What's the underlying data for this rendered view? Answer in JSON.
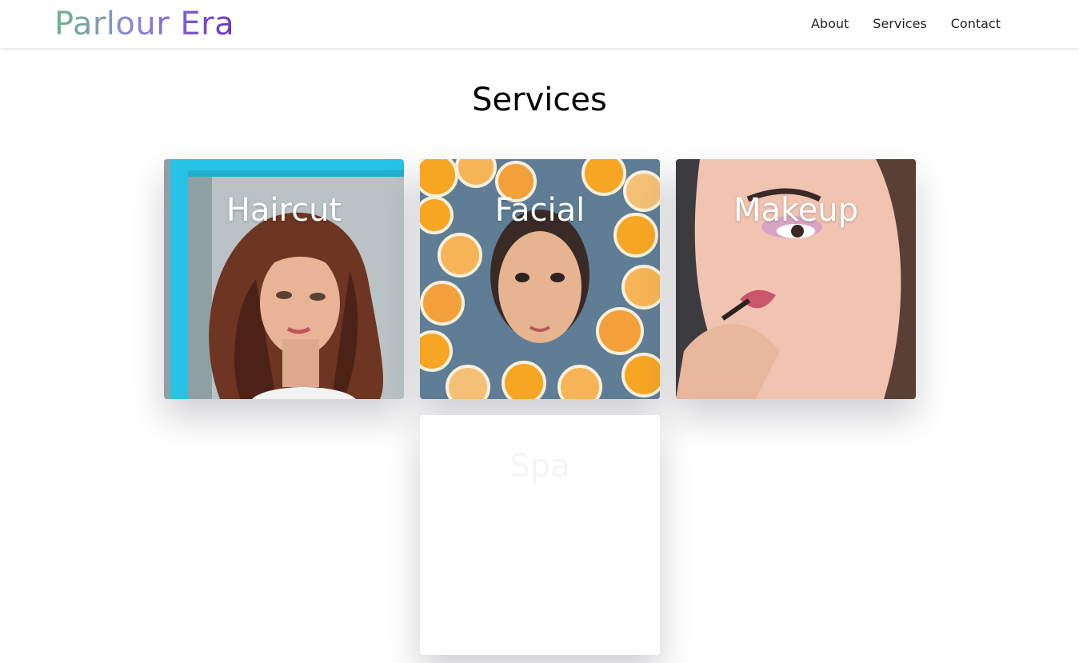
{
  "header": {
    "logo": "Parlour Era",
    "nav": [
      {
        "label": "About"
      },
      {
        "label": "Services"
      },
      {
        "label": "Contact"
      }
    ]
  },
  "main": {
    "title": "Services",
    "cards": [
      {
        "label": "Haircut"
      },
      {
        "label": "Facial"
      },
      {
        "label": "Makeup"
      },
      {
        "label": "Spa"
      }
    ]
  },
  "colors": {
    "logo_gradient_start": "#6bb58c",
    "logo_gradient_end": "#6a34c9",
    "text": "#222222",
    "background": "#ffffff"
  }
}
